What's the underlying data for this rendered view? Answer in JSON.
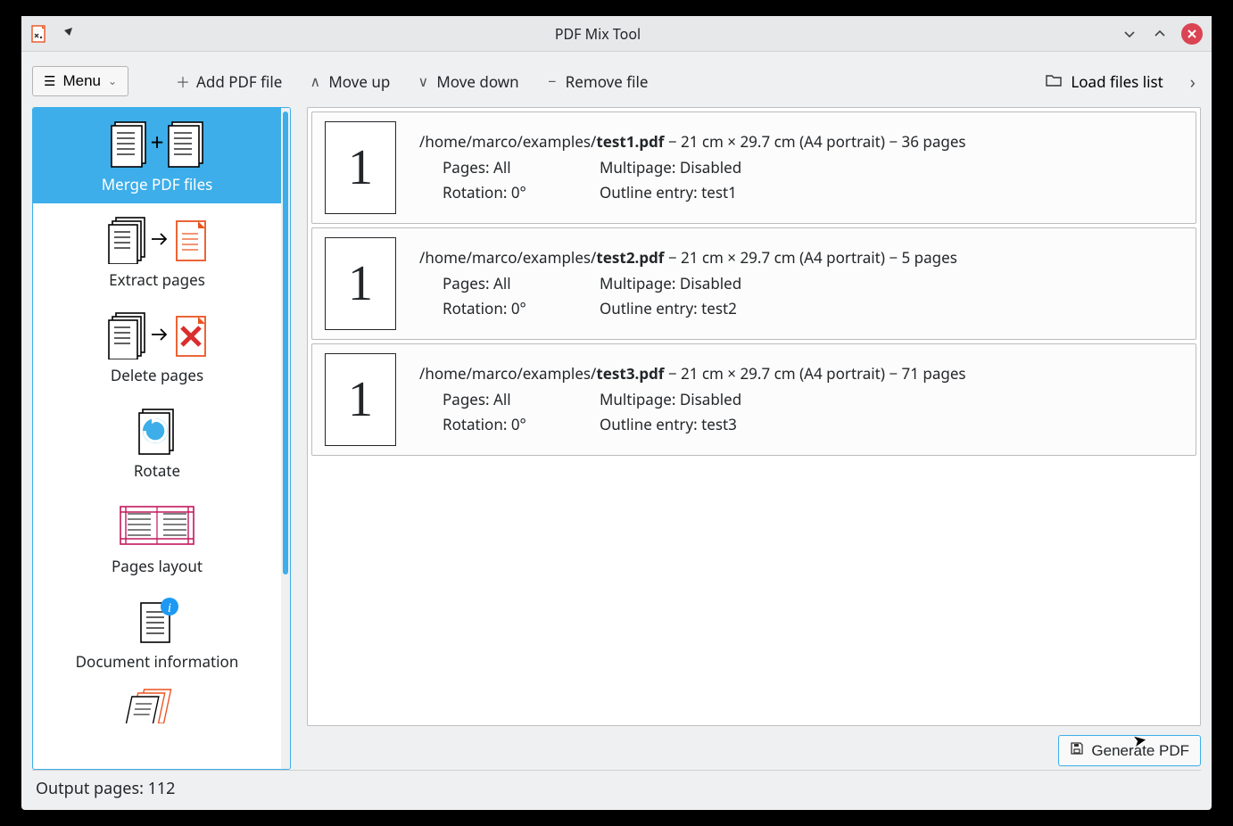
{
  "window": {
    "title": "PDF Mix Tool"
  },
  "menu_button": "Menu",
  "toolbar": {
    "add": "Add PDF file",
    "up": "Move up",
    "down": "Move down",
    "remove": "Remove file",
    "load_list": "Load files list"
  },
  "sidebar": {
    "items": [
      {
        "label": "Merge PDF files"
      },
      {
        "label": "Extract pages"
      },
      {
        "label": "Delete pages"
      },
      {
        "label": "Rotate"
      },
      {
        "label": "Pages layout"
      },
      {
        "label": "Document information"
      }
    ]
  },
  "files": [
    {
      "thumb": "1",
      "path_prefix": "/home/marco/examples/",
      "filename": "test1.pdf",
      "dims": "21 cm × 29.7 cm (A4 portrait)",
      "pages_count": "36 pages",
      "pages_label": "Pages:",
      "pages_value": "All",
      "multipage_label": "Multipage:",
      "multipage_value": "Disabled",
      "rotation_label": "Rotation:",
      "rotation_value": "0°",
      "outline_label": "Outline entry:",
      "outline_value": "test1"
    },
    {
      "thumb": "1",
      "path_prefix": "/home/marco/examples/",
      "filename": "test2.pdf",
      "dims": "21 cm × 29.7 cm (A4 portrait)",
      "pages_count": "5 pages",
      "pages_label": "Pages:",
      "pages_value": "All",
      "multipage_label": "Multipage:",
      "multipage_value": "Disabled",
      "rotation_label": "Rotation:",
      "rotation_value": "0°",
      "outline_label": "Outline entry:",
      "outline_value": "test2"
    },
    {
      "thumb": "1",
      "path_prefix": "/home/marco/examples/",
      "filename": "test3.pdf",
      "dims": "21 cm × 29.7 cm (A4 portrait)",
      "pages_count": "71 pages",
      "pages_label": "Pages:",
      "pages_value": "All",
      "multipage_label": "Multipage:",
      "multipage_value": "Disabled",
      "rotation_label": "Rotation:",
      "rotation_value": "0°",
      "outline_label": "Outline entry:",
      "outline_value": "test3"
    }
  ],
  "generate_label": "Generate PDF",
  "status": "Output pages: 112"
}
